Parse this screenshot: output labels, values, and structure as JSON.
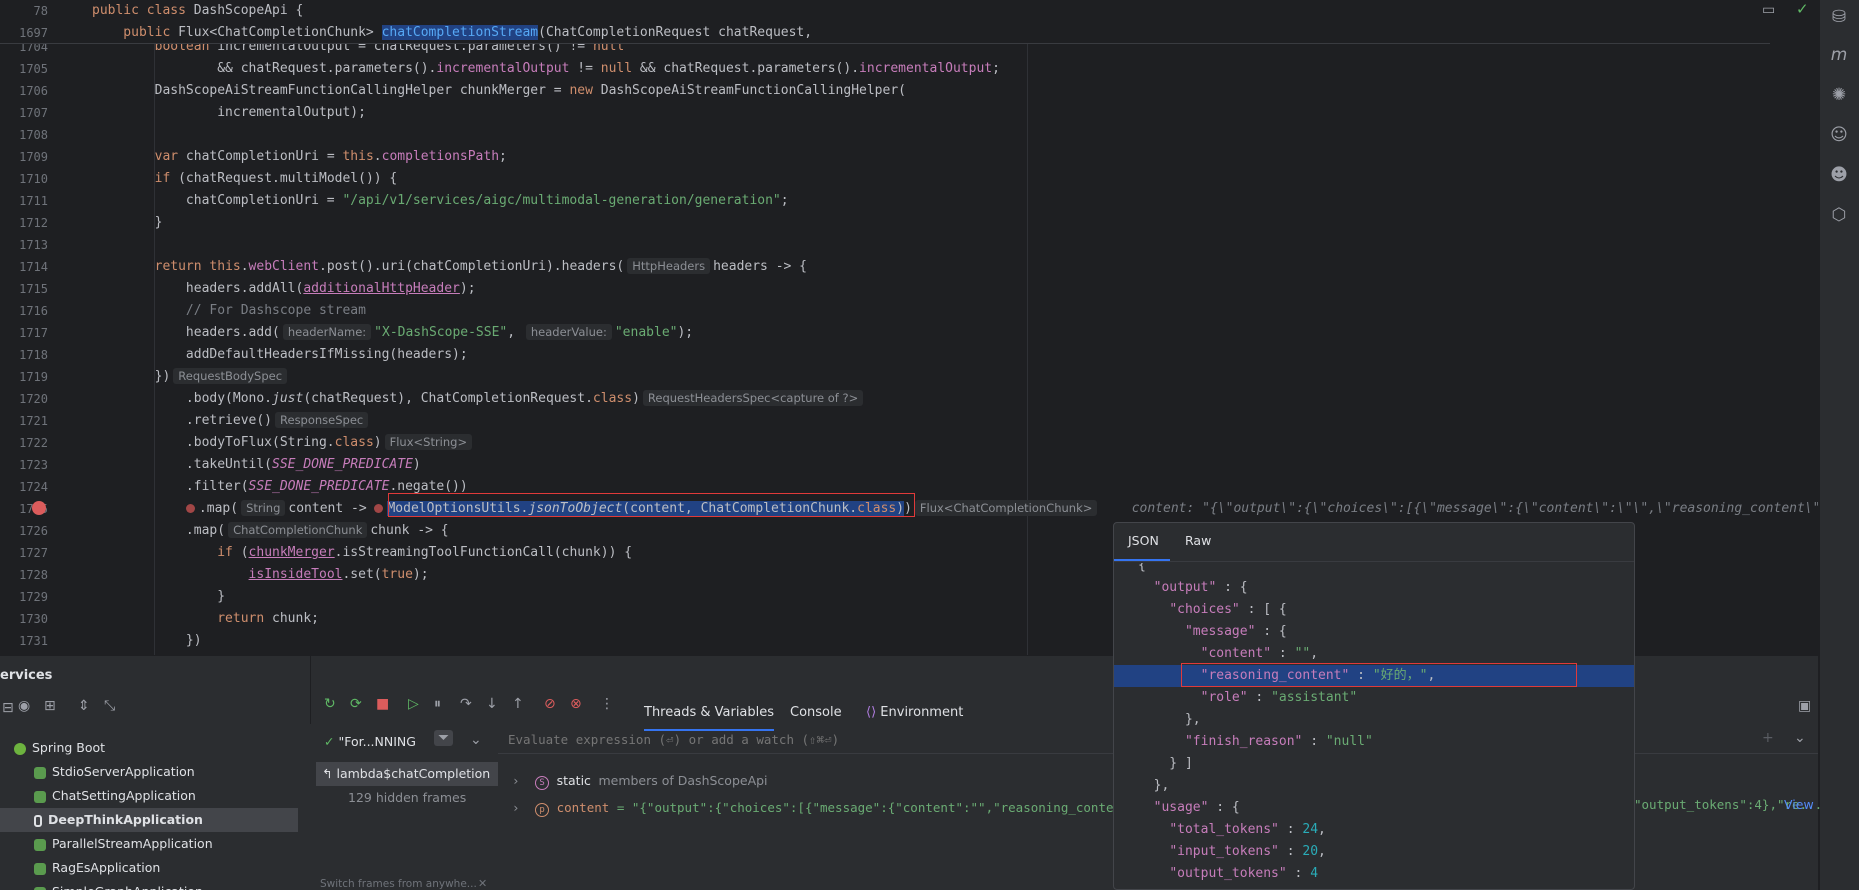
{
  "editor": {
    "sticky": [
      {
        "ln": "78",
        "parts": [
          [
            "kw",
            "public class "
          ],
          [
            "",
            "DashScopeApi {"
          ]
        ]
      },
      {
        "ln": "1697",
        "parts": [
          [
            "kw",
            "    public "
          ],
          [
            "",
            "Flux<ChatCompletionChunk> "
          ],
          [
            "sel-fn",
            "chatCompletionStream"
          ],
          [
            "",
            "(ChatCompletionRequest chatRequest,"
          ]
        ]
      }
    ],
    "lines": [
      {
        "ln": "1704",
        "html": "        <span class=\"kw\">boolean</span> incrementalOutput = chatRequest.parameters() != <span class=\"kw\">null</span>"
      },
      {
        "ln": "1705",
        "html": "                &amp;&amp; chatRequest.parameters().<span class=\"field\">incrementalOutput</span> != <span class=\"kw\">null</span> &amp;&amp; chatRequest.parameters().<span class=\"field\">incrementalOutput</span>;"
      },
      {
        "ln": "1706",
        "html": "        DashScopeAiStreamFunctionCallingHelper chunkMerger = <span class=\"kw\">new</span> DashScopeAiStreamFunctionCallingHelper("
      },
      {
        "ln": "1707",
        "html": "                incrementalOutput);"
      },
      {
        "ln": "1708",
        "html": ""
      },
      {
        "ln": "1709",
        "html": "        <span class=\"kw\">var</span> chatCompletionUri = <span class=\"kw\">this</span>.<span class=\"field\">completionsPath</span>;"
      },
      {
        "ln": "1710",
        "html": "        <span class=\"kw\">if</span> (chatRequest.multiModel()) {"
      },
      {
        "ln": "1711",
        "html": "            chatCompletionUri = <span class=\"str\">\"/api/v1/services/aigc/multimodal-generation/generation\"</span>;"
      },
      {
        "ln": "1712",
        "html": "        }"
      },
      {
        "ln": "1713",
        "html": ""
      },
      {
        "ln": "1714",
        "html": "        <span class=\"kw\">return this</span>.<span class=\"field\">webClient</span>.post().uri(chatCompletionUri).headers(<span class=\"hint\">HttpHeaders</span>headers -&gt; {"
      },
      {
        "ln": "1715",
        "html": "            headers.addAll(<span class=\"field\" style=\"text-decoration:underline\">additionalHttpHeader</span>);"
      },
      {
        "ln": "1716",
        "html": "            <span class=\"cmt\">// For Dashscope stream</span>"
      },
      {
        "ln": "1717",
        "html": "            headers.add(<span class=\"hint\">headerName:</span><span class=\"str\">\"X-DashScope-SSE\"</span>, <span class=\"hint\">headerValue:</span><span class=\"str\">\"enable\"</span>);"
      },
      {
        "ln": "1718",
        "html": "            addDefaultHeadersIfMissing(headers);"
      },
      {
        "ln": "1719",
        "html": "        })<span class=\"hint\">RequestBodySpec</span>"
      },
      {
        "ln": "1720",
        "html": "            .body(Mono.<span class=\"ital\">just</span>(chatRequest), ChatCompletionRequest.<span class=\"kw\">class</span>)<span class=\"hint\">RequestHeadersSpec&lt;capture of ?&gt;</span>"
      },
      {
        "ln": "1721",
        "html": "            .retrieve()<span class=\"hint\">ResponseSpec</span>"
      },
      {
        "ln": "1722",
        "html": "            .bodyToFlux(String.<span class=\"kw\">class</span>)<span class=\"hint\">Flux&lt;String&gt;</span>"
      },
      {
        "ln": "1723",
        "html": "            .takeUntil(<span class=\"const\">SSE_DONE_PREDICATE</span>)"
      },
      {
        "ln": "1724",
        "html": "            .filter(<span class=\"const\">SSE_DONE_PREDICATE</span>.negate())"
      },
      {
        "ln": "1725",
        "html": "            <span class=\"bp-small\"></span>.map(<span class=\"hint\">String</span>content -&gt; <span class=\"bp-small\"></span><span class=\"sel\">ModelOptionsUtils.<span class=\"ital\">jsonToObject</span>(content, ChatCompletionChunk.<span class=\"kw\">class</span>)</span>)<span class=\"hint\">Flux&lt;ChatCompletionChunk&gt;</span>    <span class=\"cmt ital\">content: \"{\\\"output\\\":{\\\"choices\\\":[{\\\"message\\\":{\\\"content\\\":\\\"\\\",\\\"reasoning_content\\\":\\\"好的，\\\",\\\"ro</span>"
      },
      {
        "ln": "1726",
        "html": "            .map(<span class=\"hint\">ChatCompletionChunk</span>chunk -&gt; {"
      },
      {
        "ln": "1727",
        "html": "                <span class=\"kw\">if</span> (<span class=\"field\" style=\"text-decoration:underline\">chunkMerger</span>.isStreamingToolFunctionCall(chunk)) {"
      },
      {
        "ln": "1728",
        "html": "                    <span class=\"field\" style=\"text-decoration:underline\">isInsideTool</span>.set(<span class=\"kw\">true</span>);"
      },
      {
        "ln": "1729",
        "html": "                }"
      },
      {
        "ln": "1730",
        "html": "                <span class=\"kw\">return</span> chunk;"
      },
      {
        "ln": "1731",
        "html": "            })"
      }
    ]
  },
  "services": {
    "title": "ervices",
    "tree": [
      {
        "label": "Spring Boot",
        "level": 0
      },
      {
        "label": "StdioServerApplication",
        "level": 1
      },
      {
        "label": "ChatSettingApplication",
        "level": 1
      },
      {
        "label": "DeepThinkApplication",
        "level": 1,
        "selected": true
      },
      {
        "label": "ParallelStreamApplication",
        "level": 1
      },
      {
        "label": "RagEsApplication",
        "level": 1
      },
      {
        "label": "SimpleGraphApplication",
        "level": 1
      }
    ]
  },
  "debugger": {
    "tabs": [
      "Threads & Variables",
      "Console",
      "Environment"
    ],
    "thread_label": "\"For...NNING",
    "frame_label": "lambda$chatCompletion",
    "hidden_frames": "129 hidden frames",
    "switch_frames": "Switch frames from anywhe...",
    "evaluate_placeholder": "Evaluate expression (⏎) or add a watch (⇧⌘⏎)",
    "static_label": "static",
    "static_text": "members of DashScopeApi",
    "content_name": "content",
    "content_value": "= \"{\"output\":{\"choices\":[{\"message\":{\"content\":\"\",\"reasoning_content\":\"好的，\",\"rol",
    "content_tail": "\"output_tokens\":4},\"re...",
    "view_link": "View"
  },
  "popup": {
    "tabs": [
      "JSON",
      "Raw"
    ],
    "lines": [
      "{",
      "  <k>\"output\"</k> : {",
      "    <k>\"choices\"</k> : [ {",
      "      <k>\"message\"</k> : {",
      "        <k>\"content\"</k> : <s>\"\"</s>,",
      "        <k>\"reasoning_content\"</k> : <s>\"好的，\"</s>,",
      "        <k>\"role\"</k> : <s>\"assistant\"</s>",
      "      },",
      "      <k>\"finish_reason\"</k> : <s>\"null\"</s>",
      "    } ]",
      "  },",
      "  <k>\"usage\"</k> : {",
      "    <k>\"total_tokens\"</k> : <n>24</n>,",
      "    <k>\"input_tokens\"</k> : <n>20</n>,",
      "    <k>\"output_tokens\"</k> : <n>4</n>"
    ]
  }
}
